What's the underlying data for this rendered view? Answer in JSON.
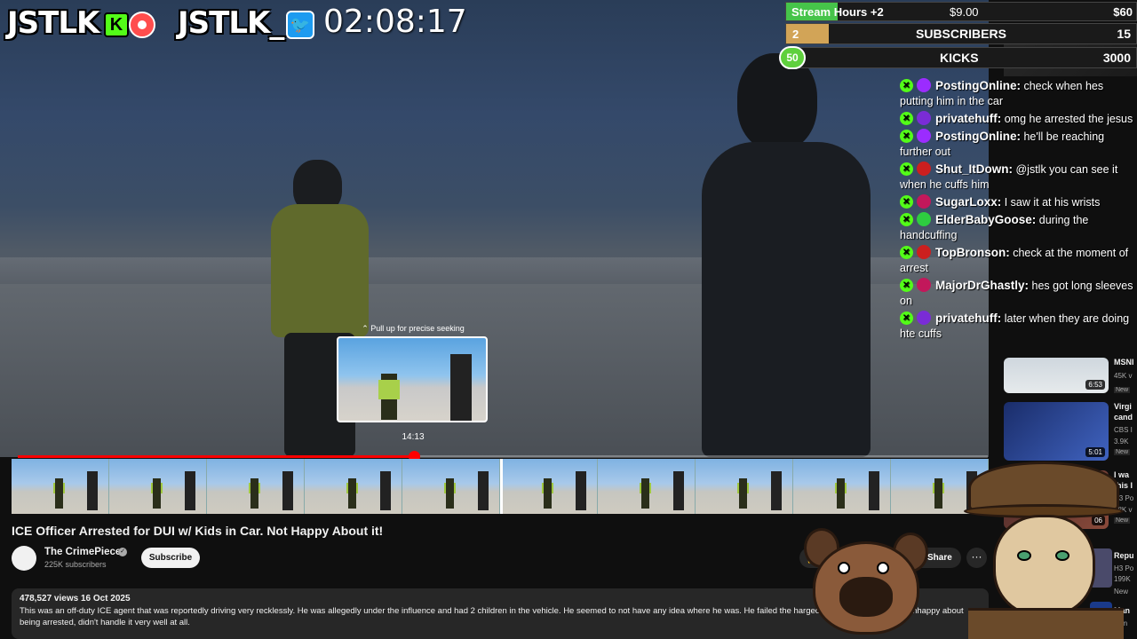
{
  "overlay": {
    "brand_kick": "JSTLK",
    "brand_twitter": "JSTLK_",
    "timer": "02:08:17",
    "goals": {
      "hours_label": "Stream Hours +2",
      "hours_amount": "$9.00",
      "hours_right": "$60",
      "subs_count": "2",
      "subs_label": "SUBSCRIBERS",
      "subs_goal": "15",
      "kicks_count": "50",
      "kicks_label": "KICKS",
      "kicks_goal": "3000"
    }
  },
  "chat": [
    {
      "user": "PostingOnline:",
      "text": " check when hes putting him in the car",
      "color": "#9b2cff"
    },
    {
      "user": "privatehuff:",
      "text": " omg he arrested the jesus",
      "color": "#7a2cd6"
    },
    {
      "user": "PostingOnline:",
      "text": " he'll be reaching further out",
      "color": "#9b2cff"
    },
    {
      "user": "Shut_ItDown:",
      "text": " @jstlk you can see it when he cuffs him",
      "color": "#cc1f1f"
    },
    {
      "user": "SugarLoxx:",
      "text": " I saw it at his wrists",
      "color": "#c2185b"
    },
    {
      "user": "ElderBabyGoose:",
      "text": " during the handcuffing",
      "color": "#2ecc40"
    },
    {
      "user": "TopBronson:",
      "text": " check at the moment of arrest",
      "color": "#cc1f1f"
    },
    {
      "user": "MajorDrGhastly:",
      "text": " hes got long sleeves on",
      "color": "#c2185b"
    },
    {
      "user": "privatehuff:",
      "text": " later when they are doing hte cuffs",
      "color": "#7a2cd6"
    }
  ],
  "player": {
    "preview_hint": "⌃ Pull up for precise seeking",
    "preview_time": "14:13",
    "progress": 0.408
  },
  "video": {
    "title": "ICE Officer Arrested for DUI w/ Kids in Car. Not Happy About it!",
    "channel": "The CrimePiece",
    "subscribers": "225K subscribers",
    "subscribe_label": "Subscribe",
    "share_label": "Share",
    "meta": "478,527 views  16 Oct 2025",
    "description": "This was an off-duty ICE agent that was reportedly driving very recklessly. He was allegedly under the influence and had 2 children in the vehicle. He seemed to not have any idea where he was. He failed the                                    harged with DUI. He was very unhappy about being arrested, didn't handle it very well at all."
  },
  "related": [
    {
      "title": "MSNI",
      "stat": "45K v",
      "badge": "New",
      "duration": "6:53"
    },
    {
      "title": "Virgi",
      "line2": "cand",
      "stat": "CBS I",
      "stat2": "3.9K",
      "badge": "New",
      "duration": "5:01"
    },
    {
      "title": "I wa",
      "line2": "this I",
      "stat": "H3 Po",
      "stat2": "98K v",
      "badge": "New",
      "duration": "06"
    }
  ],
  "far_right": {
    "t1": "Repu",
    "s1": "H3 Po",
    "s2": "199K",
    "b1": "New",
    "t2": "Man",
    "s3": "cam"
  }
}
